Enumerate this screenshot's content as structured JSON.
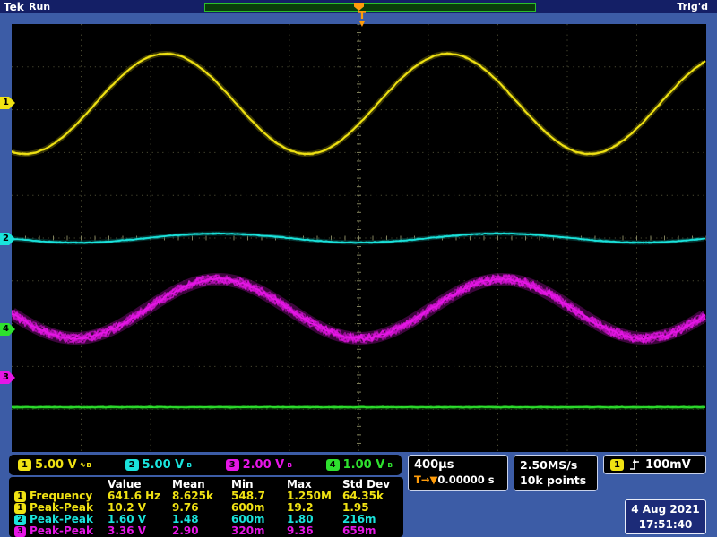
{
  "colors": {
    "ch1": "#f0e213",
    "ch2": "#1ae3dc",
    "ch3": "#e616e6",
    "ch4": "#2ee02e",
    "accent_orange": "#ff9c0a",
    "frame_blue": "#3c5ca6"
  },
  "header": {
    "brand": "Tek",
    "run_state": "Run",
    "trig_state": "Trig'd"
  },
  "trigger_flag": {
    "label": "T",
    "arrow": "▼"
  },
  "channel_markers": [
    {
      "label": "1"
    },
    {
      "label": "2"
    },
    {
      "label": "4"
    },
    {
      "label": "3"
    }
  ],
  "scale_readouts": [
    {
      "ch": "1",
      "scale": "5.00 V",
      "icons": "∿ʙ"
    },
    {
      "ch": "2",
      "scale": "5.00 V",
      "icons": "ʙ"
    },
    {
      "ch": "3",
      "scale": "2.00 V",
      "icons": "ʙ"
    },
    {
      "ch": "4",
      "scale": "1.00 V",
      "icons": "ʙ"
    }
  ],
  "timebase": {
    "scale": "400µs",
    "trig_label": "T",
    "trig_arrows": "→▼",
    "trig_pos": "0.00000 s"
  },
  "acquisition": {
    "sample_rate": "2.50MS/s",
    "record_length": "10k points"
  },
  "trigger": {
    "source": "1",
    "level": "100mV"
  },
  "datetime": {
    "date": "4 Aug 2021",
    "time": "17:51:40"
  },
  "measurements": {
    "headers": [
      "Value",
      "Mean",
      "Min",
      "Max",
      "Std Dev"
    ],
    "rows": [
      {
        "ch": "1",
        "name": "Frequency",
        "values": [
          "641.6 Hz",
          "8.625k",
          "548.7",
          "1.250M",
          "64.35k"
        ]
      },
      {
        "ch": "1",
        "name": "Peak-Peak",
        "values": [
          "10.2 V",
          "9.76",
          "600m",
          "19.2",
          "1.95"
        ]
      },
      {
        "ch": "2",
        "name": "Peak-Peak",
        "values": [
          "1.60 V",
          "1.48",
          "600m",
          "1.80",
          "216m"
        ]
      },
      {
        "ch": "3",
        "name": "Peak-Peak",
        "values": [
          "3.36 V",
          "2.90",
          "320m",
          "9.36",
          "659m"
        ]
      }
    ]
  },
  "chart_data": {
    "type": "line",
    "title": "Oscilloscope waveform display",
    "x_axis": {
      "per_div": "400µs",
      "divisions": 10
    },
    "y_axis": {
      "divisions": 10,
      "per_div": {
        "ch1": "5.00 V",
        "ch2": "5.00 V",
        "ch3": "2.00 V",
        "ch4": "1.00 V"
      }
    },
    "grid": {
      "cols": 10,
      "rows": 10,
      "color": "#4a4a32",
      "tick_color": "#80805c"
    },
    "series": [
      {
        "id": "ch1",
        "desc": "sine ~641.6 Hz, 10.2 Vpp",
        "color": "#f0e213",
        "halo": "#6d6708",
        "center": 89,
        "amp": 56,
        "period": 315,
        "peak_x": 172,
        "noise": 1.0,
        "passes": 3,
        "width": 1.8,
        "halo_width": 6
      },
      {
        "id": "ch2",
        "desc": "small sine, 1.60 Vpp",
        "color": "#1ae3dc",
        "halo": "#0a5f5c",
        "center": 239,
        "amp": 5,
        "period": 315,
        "peak_x": 230,
        "noise": 0.9,
        "passes": 3,
        "width": 1.6,
        "halo_width": 5
      },
      {
        "id": "ch3",
        "desc": "noisy sine, 3.36 Vpp",
        "color": "#e616e6",
        "halo": "#7a0b7a",
        "center": 318,
        "amp": 33,
        "period": 317,
        "peak_x": 230,
        "noise": 5.5,
        "passes": 9,
        "width": 1.6,
        "halo_width": 14
      },
      {
        "id": "ch4",
        "desc": "flat DC line",
        "color": "#2ee02e",
        "halo": "#0c660c",
        "center": 428,
        "amp": 0,
        "period": 315,
        "peak_x": 0,
        "noise": 0.9,
        "passes": 3,
        "width": 1.6,
        "halo_width": 5
      }
    ]
  }
}
